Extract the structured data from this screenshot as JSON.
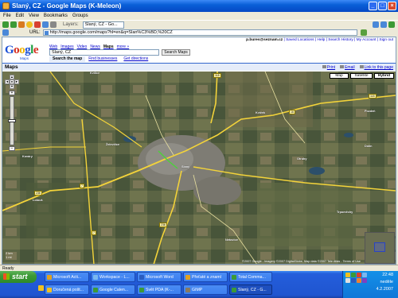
{
  "window": {
    "title": "Slaný, CZ - Google Maps (K-Meleon)",
    "controls": [
      "_",
      "□",
      "×"
    ]
  },
  "menu": [
    "File",
    "Edit",
    "View",
    "Bookmarks",
    "Groups"
  ],
  "toolbar": {
    "layers_label": "Layers:",
    "layer_tab": "Slaný, CZ - Go...",
    "icons": [
      "back-icon",
      "forward-icon",
      "home-icon",
      "bookmark-star-icon",
      "stop-icon",
      "reload-icon",
      "print-icon"
    ]
  },
  "urlbar": {
    "label": "URL:",
    "url": "http://maps.google.com/maps?hl=en&q=Slan%C3%BD,%20CZ"
  },
  "google": {
    "user_links": {
      "email": "p.bures@seznam.cz",
      "links": [
        "Saved Locations",
        "Help",
        "Search History",
        "My Account",
        "Sign out"
      ]
    },
    "logo_letters": [
      "G",
      "o",
      "o",
      "g",
      "l",
      "e"
    ],
    "logo_sub": "Maps",
    "nav": [
      "Web",
      "Images",
      "Video",
      "News",
      "Maps",
      "more »"
    ],
    "nav_active": "Maps",
    "search_value": "Slaný, CZ",
    "search_button": "Search Maps",
    "subtabs": [
      "Search the map",
      "Find businesses",
      "Get directions"
    ],
    "section_title": "Maps",
    "actions": [
      "Print",
      "Email",
      "Link to this page"
    ]
  },
  "map": {
    "types": [
      "Map",
      "Satellite",
      "Hybrid"
    ],
    "active_type": "Hybrid",
    "pan": [
      "▲",
      "◄",
      "●",
      "►",
      "▼"
    ],
    "zoom_in": "+",
    "zoom_out": "−",
    "scale": [
      "2 km",
      "1 mi"
    ],
    "copyright": "©2007 Google - Imagery ©2007 DigitalGlobe, Map data ©2007 Tele Atlas - Terms of Use",
    "places": [
      "Slaný",
      "Kvílice",
      "Otruby",
      "Dolín",
      "Lotouš",
      "Kvíček",
      "Želevčice",
      "Trpoměchy",
      "Netovice",
      "Pozdeň",
      "Kováry"
    ],
    "road_numbers": [
      "118",
      "7",
      "16",
      "236",
      "7",
      "236",
      "118"
    ]
  },
  "statusbar": "Ready",
  "taskbar": {
    "start": "start",
    "tasks_row1": [
      "Microsoft Acti...",
      "Workspace - L...",
      "Microsoft Word",
      "Přeťaté a znamí",
      "Total Comma..."
    ],
    "tasks_row2": [
      "Doručená pošt...",
      "Google Calen...",
      "Svět PDA (K-...",
      "GIMP",
      "Slaný, CZ - G..."
    ],
    "active_task": "Slaný, CZ - G...",
    "clock": {
      "time": "22:48",
      "day": "neděle",
      "date": "4.2.2007"
    }
  }
}
